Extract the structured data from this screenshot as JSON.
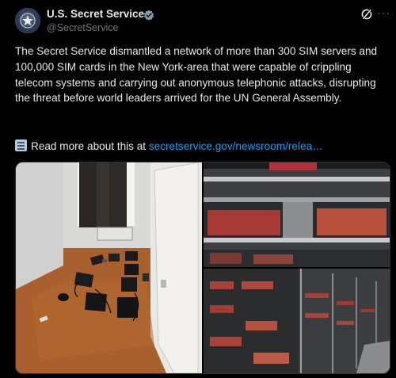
{
  "account": {
    "name": "U.S. Secret Service",
    "handle": "@SecretService",
    "verified": true,
    "avatar": "secret-service-star-seal"
  },
  "post": {
    "text": "The Secret Service dismantled a network of more than 300 SIM servers and 100,000 SIM cards in the New York-area that were capable of crippling telecom systems and carrying out anonymous telephonic attacks, disrupting the threat before world leaders arrived for the UN General Assembly.",
    "link_prefix": "Read more about this at",
    "link_text": "secretservice.gov/newsroom/relea…",
    "link_icon": "newspaper-icon"
  },
  "media": {
    "images": [
      {
        "description": "room-with-devices-on-floor"
      },
      {
        "description": "server-racks-with-sim-cards"
      }
    ]
  },
  "colors": {
    "background": "#000000",
    "text": "#e7e9ea",
    "muted": "#71767b",
    "link": "#1d9bf0",
    "verified_badge": "#829aab"
  }
}
